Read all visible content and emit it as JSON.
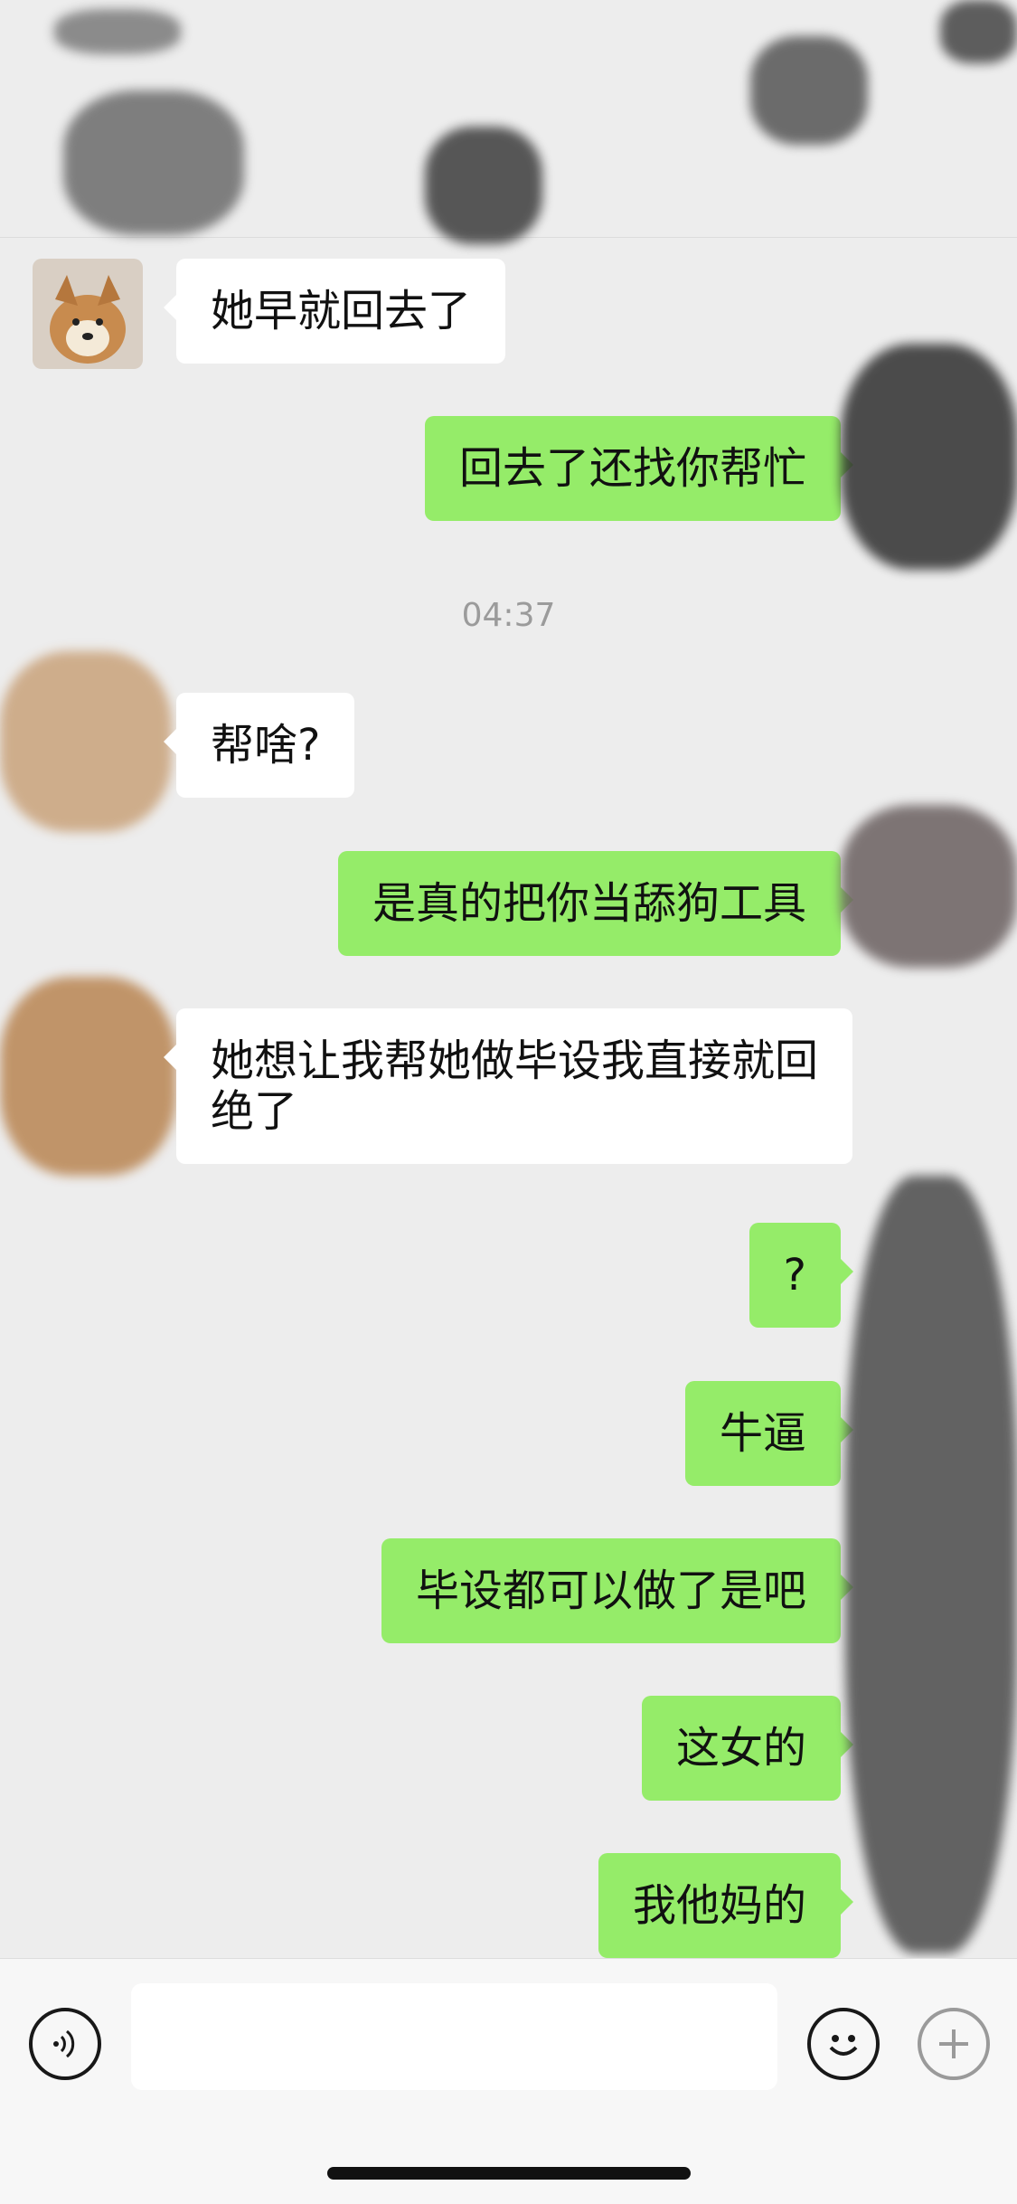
{
  "header": {
    "title": ""
  },
  "messages": [
    {
      "id": "m1",
      "side": "left",
      "text": "她早就回去了"
    },
    {
      "id": "m2",
      "side": "right",
      "text": "回去了还找你帮忙"
    },
    {
      "id": "ts1",
      "type": "timestamp",
      "text": "04:37"
    },
    {
      "id": "m3",
      "side": "left",
      "text": "帮啥?"
    },
    {
      "id": "m4",
      "side": "right",
      "text": "是真的把你当舔狗工具"
    },
    {
      "id": "m5",
      "side": "left",
      "text": "她想让我帮她做毕设我直接就回绝了"
    },
    {
      "id": "m6",
      "side": "right",
      "text": "?"
    },
    {
      "id": "m7",
      "side": "right",
      "text": "牛逼"
    },
    {
      "id": "m8",
      "side": "right",
      "text": "毕设都可以做了是吧"
    },
    {
      "id": "m9",
      "side": "right",
      "text": "这女的"
    },
    {
      "id": "m10",
      "side": "right",
      "text": "我他妈的"
    }
  ],
  "input_bar": {
    "placeholder": "",
    "voice_icon": "voice-icon",
    "emoji_icon": "emoji-icon",
    "plus_icon": "plus-icon"
  },
  "colors": {
    "background": "#ededed",
    "bubble_self": "#95ec69",
    "bubble_other": "#ffffff",
    "timestamp": "#9b9b9b"
  }
}
